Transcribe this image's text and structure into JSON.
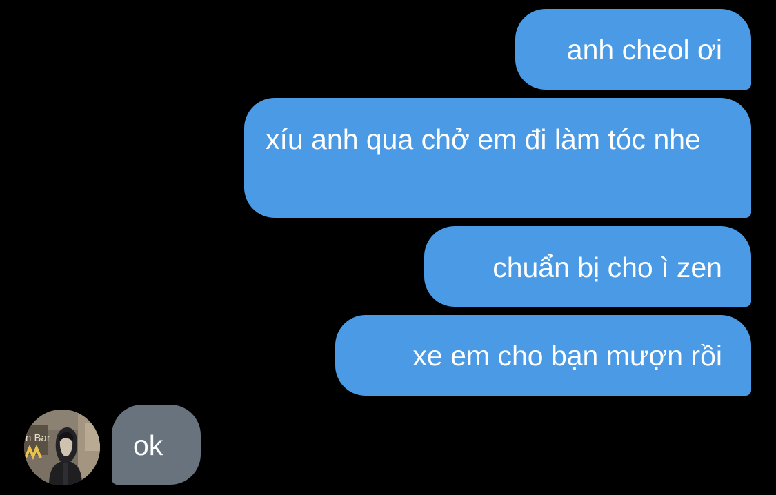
{
  "theme": {
    "background": "#000000",
    "outgoing_bubble": "#4a9ae6",
    "incoming_bubble": "#69737d",
    "text_color": "#ffffff"
  },
  "messages": [
    {
      "direction": "outgoing",
      "text": "anh cheol ơi"
    },
    {
      "direction": "outgoing",
      "text": "xíu anh qua chở em đi làm tóc nhe"
    },
    {
      "direction": "outgoing",
      "text": "chuẩn bị cho ì zen"
    },
    {
      "direction": "outgoing",
      "text": "xe em cho bạn mượn rồi"
    },
    {
      "direction": "incoming",
      "text": "ok"
    }
  ],
  "avatar": {
    "icon": "contact-avatar-photo",
    "sign_text": "n Bar"
  }
}
